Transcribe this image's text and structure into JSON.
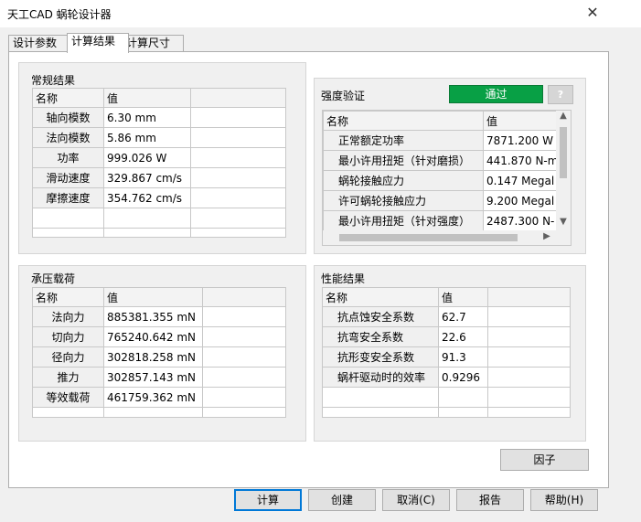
{
  "window": {
    "title": "天工CAD 蜗轮设计器"
  },
  "tabs": [
    {
      "label": "设计参数"
    },
    {
      "label": "计算结果"
    },
    {
      "label": "计算尺寸"
    }
  ],
  "regular": {
    "title": "常规结果",
    "headers": [
      "名称",
      "值"
    ],
    "rows": [
      {
        "name": "轴向模数",
        "value": "6.30 mm"
      },
      {
        "name": "法向模数",
        "value": "5.86 mm"
      },
      {
        "name": "功率",
        "value": "999.026 W"
      },
      {
        "name": "滑动速度",
        "value": "329.867 cm/s"
      },
      {
        "name": "摩擦速度",
        "value": "354.762 cm/s"
      }
    ]
  },
  "strength": {
    "title": "强度验证",
    "status": "通过",
    "help": "?",
    "headers": [
      "名称",
      "值"
    ],
    "rows": [
      {
        "name": "正常额定功率",
        "value": "7871.200 W"
      },
      {
        "name": "最小许用扭矩（针对磨损）",
        "value": "441.870 N-m"
      },
      {
        "name": "蜗轮接触应力",
        "value": "0.147 Megal"
      },
      {
        "name": "许可蜗轮接触应力",
        "value": "9.200 Megal"
      },
      {
        "name": "最小许用扭矩（针对强度）",
        "value": "2487.300 N-"
      }
    ]
  },
  "load": {
    "title": "承压载荷",
    "headers": [
      "名称",
      "值"
    ],
    "rows": [
      {
        "name": "法向力",
        "value": "885381.355 mN"
      },
      {
        "name": "切向力",
        "value": "765240.642 mN"
      },
      {
        "name": "径向力",
        "value": "302818.258 mN"
      },
      {
        "name": "推力",
        "value": "302857.143 mN"
      },
      {
        "name": "等效载荷",
        "value": "461759.362 mN"
      }
    ]
  },
  "performance": {
    "title": "性能结果",
    "headers": [
      "名称",
      "值"
    ],
    "rows": [
      {
        "name": "抗点蚀安全系数",
        "value": "62.7"
      },
      {
        "name": "抗弯安全系数",
        "value": "22.6"
      },
      {
        "name": "抗形变安全系数",
        "value": "91.3"
      },
      {
        "name": "蜗杆驱动时的效率",
        "value": "0.9296"
      }
    ]
  },
  "buttons": {
    "factor": "因子",
    "calculate": "计算",
    "create": "创建",
    "cancel": "取消(C)",
    "report": "报告",
    "help": "帮助(H)"
  },
  "icons": {
    "close": "close-icon"
  },
  "colors": {
    "pass": "#08a045",
    "default_button_border": "#0078d7"
  }
}
